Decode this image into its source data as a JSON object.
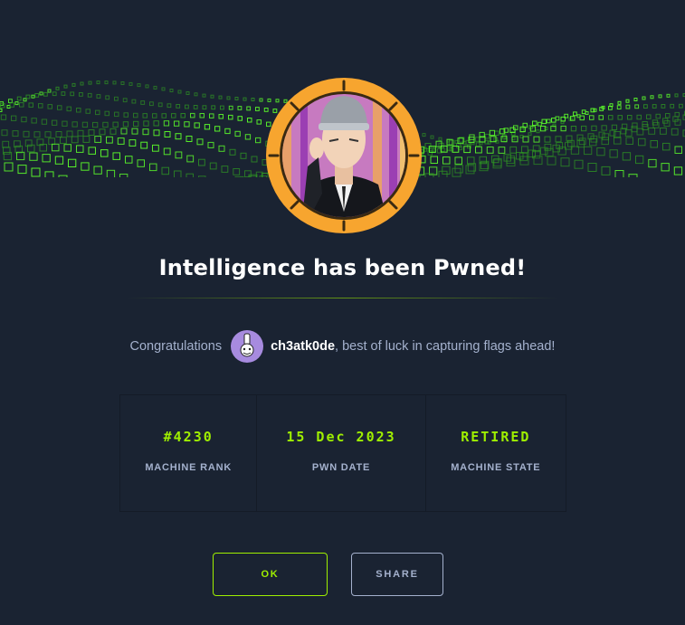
{
  "page": {
    "title": "Intelligence has been Pwned!"
  },
  "congrats": {
    "prefix": "Congratulations",
    "username": "ch3atk0de",
    "suffix": ", best of luck in capturing flags ahead!"
  },
  "stats": [
    {
      "value": "#4230",
      "label": "MACHINE RANK"
    },
    {
      "value": "15 Dec 2023",
      "label": "PWN DATE"
    },
    {
      "value": "RETIRED",
      "label": "MACHINE STATE"
    }
  ],
  "buttons": {
    "ok": "OK",
    "share": "SHARE"
  },
  "colors": {
    "background": "#1a2332",
    "accent": "#9fef00",
    "muted": "#a4b1cd",
    "avatar_ring": "#f7a52f"
  },
  "icons": {
    "banner": "green-cube-wave-graphic",
    "machine_avatar": "intelligence-machine-avatar",
    "user_avatar": "user-avatar-robot"
  }
}
